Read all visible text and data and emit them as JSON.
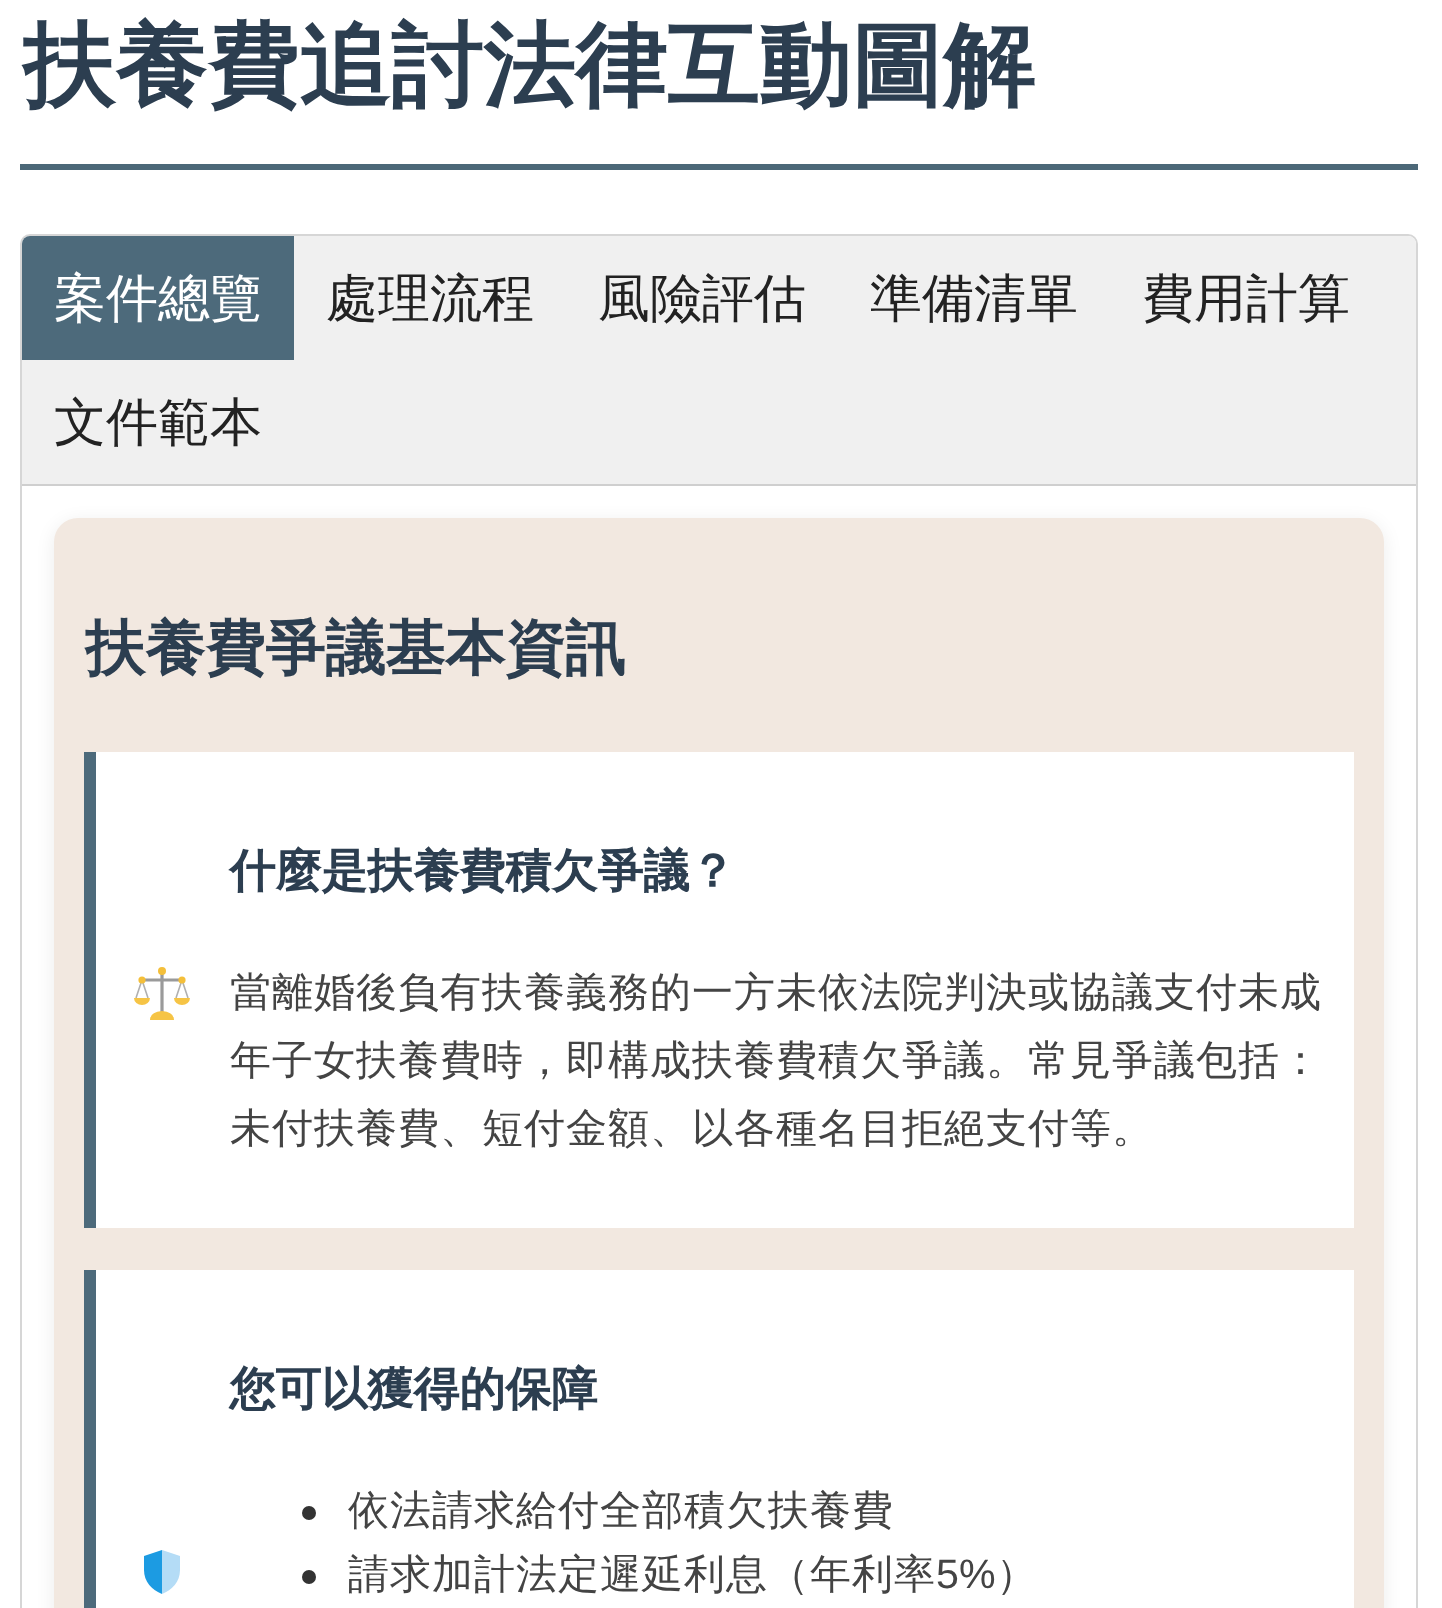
{
  "title": "扶養費追討法律互動圖解",
  "tabs": [
    {
      "label": "案件總覽",
      "selected": true
    },
    {
      "label": "處理流程",
      "selected": false
    },
    {
      "label": "風險評估",
      "selected": false
    },
    {
      "label": "準備清單",
      "selected": false
    },
    {
      "label": "費用計算",
      "selected": false
    },
    {
      "label": "文件範本",
      "selected": false
    }
  ],
  "card": {
    "title": "扶養費爭議基本資訊",
    "sections": [
      {
        "kind": "paragraph",
        "title": "什麼是扶養費積欠爭議？",
        "text": "當離婚後負有扶養義務的一方未依法院判決或協議支付未成年子女扶養費時，即構成扶養費積欠爭議。常見爭議包括：未付扶養費、短付金額、以各種名目拒絕支付等。"
      },
      {
        "kind": "list",
        "title": "您可以獲得的保障",
        "items": [
          "依法請求給付全部積欠扶養費",
          "請求加計法定遲延利息（年利率5%）"
        ]
      }
    ]
  }
}
